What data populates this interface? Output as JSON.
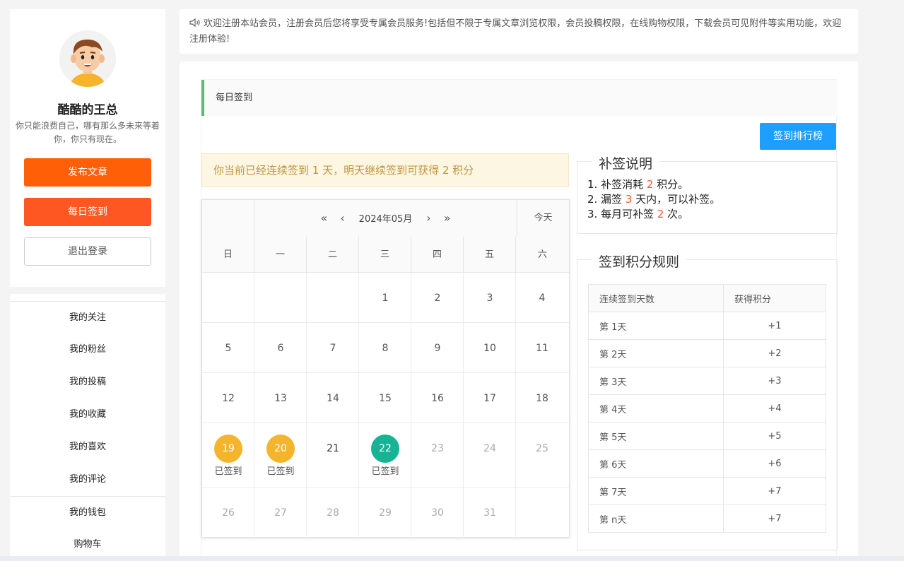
{
  "sidebar": {
    "username": "酷酷的王总",
    "bio": "你只能浪费自己，哪有那么多未来等着你，你只有现在。",
    "buttons": {
      "publish": "发布文章",
      "sign": "每日签到",
      "logout": "退出登录"
    },
    "menu": [
      "我的关注",
      "我的粉丝",
      "我的投稿",
      "我的收藏",
      "我的喜欢",
      "我的评论",
      "我的钱包",
      "购物车"
    ]
  },
  "notice": {
    "text": "欢迎注册本站会员，注册会员后您将享受专属会员服务!包括但不限于专属文章浏览权限，会员投稿权限，在线购物权限，下载会员可见附件等实用功能，欢迎注册体验!"
  },
  "main": {
    "section_title": "每日签到",
    "rank_button": "签到排行榜",
    "streak_message": "你当前已经连续签到 1 天，明天继续签到可获得 2 积分"
  },
  "calendar": {
    "month_label": "2024年05月",
    "today_label": "今天",
    "weekdays": [
      "日",
      "一",
      "二",
      "三",
      "四",
      "五",
      "六"
    ],
    "signed_label": "已签到",
    "prev_year": "«",
    "prev_month": "‹",
    "next_month": "›",
    "next_year": "»"
  },
  "makeup": {
    "legend": "补签说明",
    "line1_pre": "1. 补签消耗 ",
    "line1_num": "2",
    "line1_post": " 积分。",
    "line2_pre": "2. 漏签 ",
    "line2_num": "3",
    "line2_post": " 天内，可以补签。",
    "line3_pre": "3. 每月可补签 ",
    "line3_num": "2",
    "line3_post": " 次。"
  },
  "points_rules": {
    "legend": "签到积分规则",
    "headers": [
      "连续签到天数",
      "获得积分"
    ],
    "rows": [
      [
        "第 1天",
        "+1"
      ],
      [
        "第 2天",
        "+2"
      ],
      [
        "第 3天",
        "+3"
      ],
      [
        "第 4天",
        "+4"
      ],
      [
        "第 5天",
        "+5"
      ],
      [
        "第 6天",
        "+6"
      ],
      [
        "第 7天",
        "+7"
      ],
      [
        "第 n天",
        "+7"
      ]
    ]
  },
  "colors": {
    "publish": "#ff5f07",
    "sign": "#ff5722",
    "rank": "#1e9fff",
    "signed_day": "#f4b52c",
    "today": "#16b494",
    "title_accent": "#5fb878"
  }
}
